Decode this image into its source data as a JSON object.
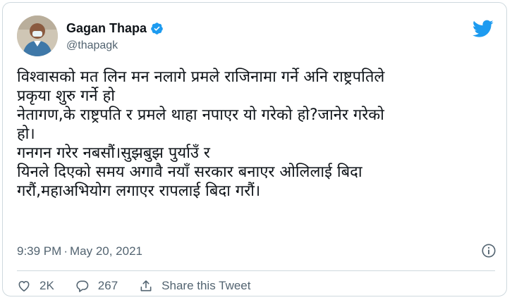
{
  "author": {
    "name": "Gagan Thapa",
    "handle": "@thapagk"
  },
  "tweet": {
    "lines": [
      "विश्वासको मत लिन मन नलागे प्रमले राजिनामा गर्ने अनि राष्ट्रपतिले",
      "प्रकृया शुरु गर्ने हो",
      "नेतागण,के राष्ट्रपति र प्रमले थाहा नपाएर यो गरेको हो?जानेर गरेको",
      "हो।",
      "गनगन गरेर नबसौं।सुझबुझ पुर्याउँ र",
      "यिनले दिएको समय अगावै नयाँ सरकार बनाएर ओलिलाई बिदा",
      "गरौं,महाअभियोग लगाएर रापलाई बिदा गरौं।"
    ],
    "time": "9:39 PM",
    "separator": "·",
    "date": "May 20, 2021"
  },
  "actions": {
    "likes": "2K",
    "replies": "267",
    "share_label": "Share this Tweet"
  },
  "colors": {
    "twitter_blue": "#1d9bf0",
    "secondary_text": "#536471",
    "border": "#cfd9de"
  },
  "icons": [
    "verified-badge-icon",
    "twitter-bird-icon",
    "info-icon",
    "heart-icon",
    "reply-bubble-icon",
    "share-icon"
  ]
}
